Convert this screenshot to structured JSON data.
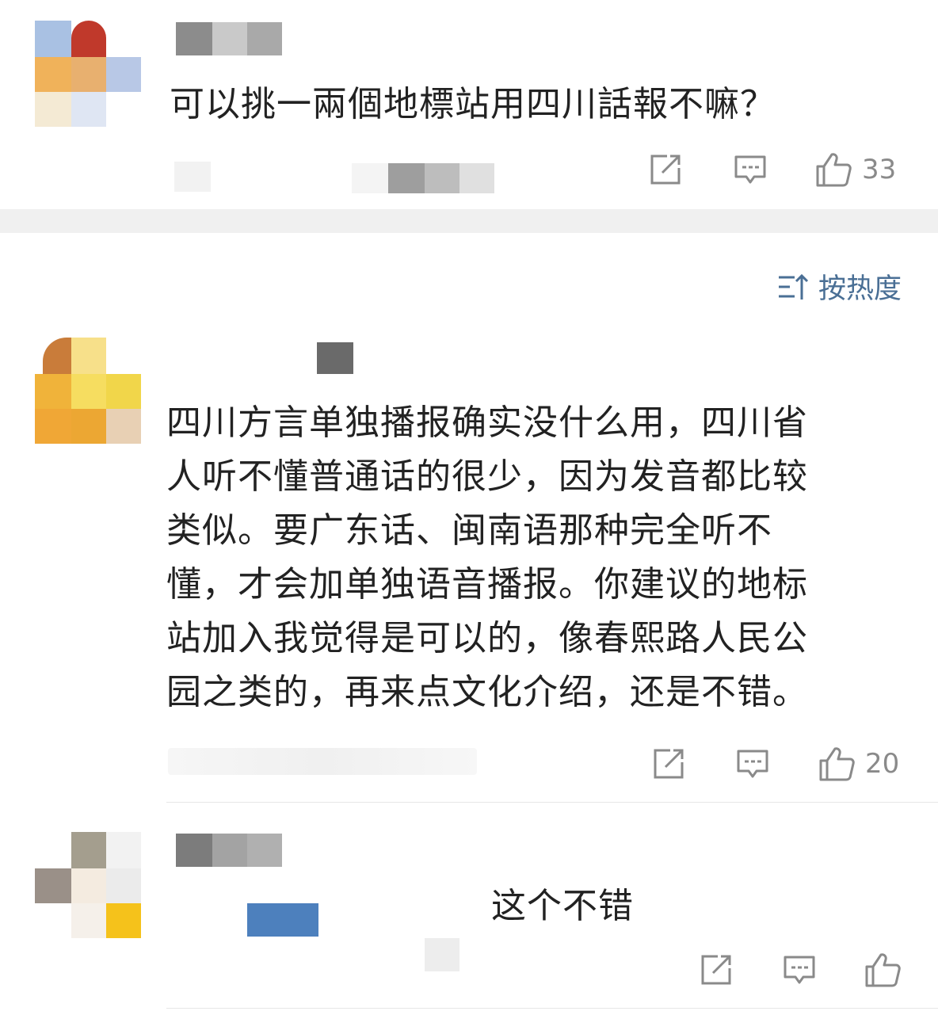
{
  "comments": [
    {
      "text": "可以挑一兩個地標站用四川話報不嘛？",
      "likes": "33"
    },
    {
      "text_lines": [
        "四川方言单独播报确实没什么用，四川省",
        "人听不懂普通话的很少，因为发音都比较",
        "类似。要广东话、闽南语那种完全听不",
        "懂，才会加单独语音播报。你建议的地标",
        "站加入我觉得是可以的，像春熙路人民公",
        "园之类的，再来点文化介绍，还是不错。"
      ],
      "likes": "20"
    },
    {
      "text": "这个不错",
      "likes": ""
    }
  ],
  "sort": {
    "label": "按热度"
  },
  "icons": {
    "share": "share-icon",
    "reply": "comment-icon",
    "like": "thumbs-up-icon",
    "sort": "sort-icon"
  },
  "colors": {
    "accent": "#4a6f95",
    "icon": "#8a8a8a",
    "divider": "#f0f0f0"
  }
}
